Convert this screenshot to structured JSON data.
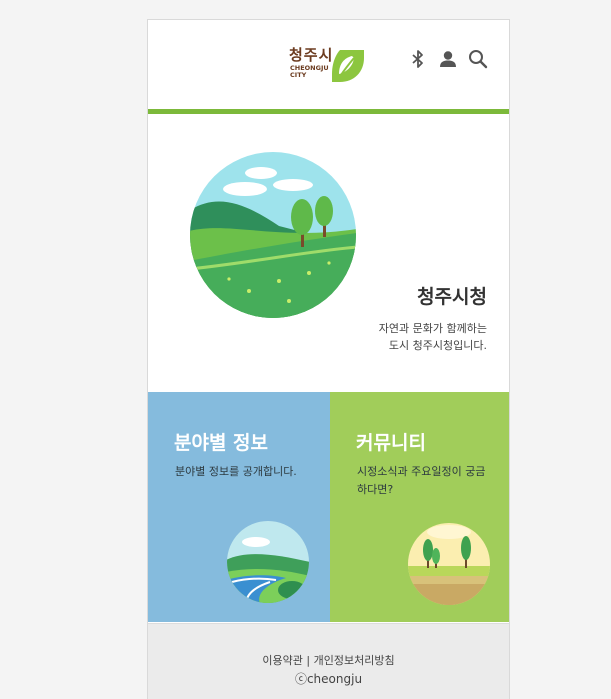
{
  "header": {
    "logo_ko": "청주시",
    "logo_en": "CHEONGJU CITY",
    "icons": [
      "bluetooth-icon",
      "user-icon",
      "search-icon"
    ]
  },
  "hero": {
    "title": "청주시청",
    "desc_line1": "자연과 문화가 함께하는",
    "desc_line2": "도시 청주시청입니다."
  },
  "cards": [
    {
      "title": "분야별 정보",
      "desc": "분야별 정보를 공개합니다.",
      "color": "#85bbdd"
    },
    {
      "title": "커뮤니티",
      "desc": "시정소식과 주요일정이 궁금하다면?",
      "color": "#a1cd5a"
    }
  ],
  "footer": {
    "terms": "이용약관",
    "separator": " | ",
    "privacy": "개인정보처리방침",
    "copyright": "ⓒcheongju"
  },
  "colors": {
    "accent_green": "#7cb93a",
    "logo_brown": "#6b3b1f",
    "card_blue": "#85bbdd",
    "card_green": "#a1cd5a"
  }
}
